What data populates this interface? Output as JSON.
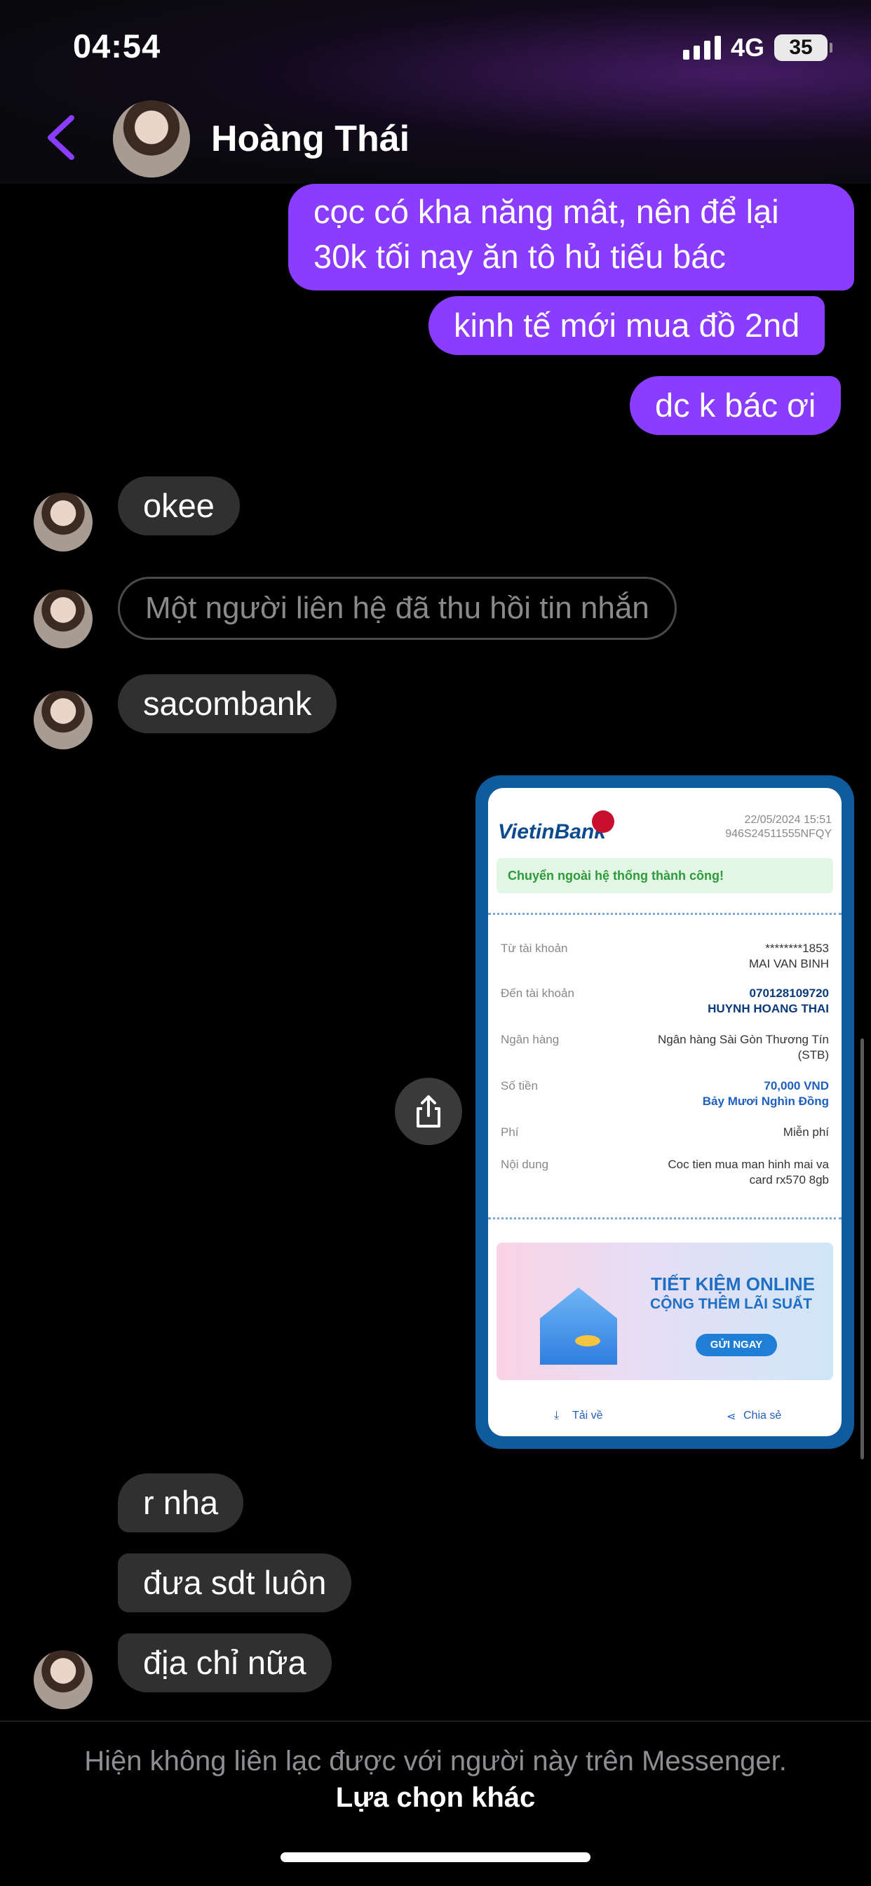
{
  "status_bar": {
    "time": "04:54",
    "network": "4G",
    "battery": "35"
  },
  "header": {
    "contact_name": "Hoàng Thái"
  },
  "messages": {
    "sent_1": "cọc có kha năng mât, nên để lại\n30k tối nay ăn tô hủ tiếu bác",
    "sent_2": "kinh tế mới mua đồ 2nd",
    "sent_3": "dc k bác ơi",
    "recv_1": "okee",
    "unsent": "Một người liên hệ đã thu hồi tin nhắn",
    "recv_2": "sacombank",
    "recv_3": "r nha",
    "recv_4": "đưa sdt luôn",
    "recv_5": "địa chỉ nữa"
  },
  "receipt": {
    "logo": "VietinBank",
    "date": "22/05/2024 15:51",
    "ref": "946S24511555NFQY",
    "success": "Chuyển ngoài hệ thống thành công!",
    "rows": [
      {
        "label": "Từ tài khoản",
        "value1": "********1853",
        "value2": "MAI VAN BINH"
      },
      {
        "label": "Đến tài khoản",
        "value1": "070128109720",
        "value2": "HUYNH HOANG THAI"
      },
      {
        "label": "Ngân hàng",
        "value1": "Ngân hàng Sài Gòn Thương Tín",
        "value2": "(STB)"
      },
      {
        "label": "Số tiền",
        "value1": "70,000 VND",
        "value2": "Bảy Mươi Nghìn Đồng"
      },
      {
        "label": "Phí",
        "value1": "Miễn phí",
        "value2": ""
      },
      {
        "label": "Nội dung",
        "value1": "Coc tien mua man hinh mai va",
        "value2": "card rx570 8gb"
      }
    ],
    "banner_title": "TIẾT KIỆM ONLINE",
    "banner_subtitle": "CỘNG THÊM LÃI SUẤT",
    "banner_button": "GỬI NGAY",
    "download": "Tải về",
    "share": "Chia sẻ"
  },
  "footer": {
    "note": "Hiện không liên lạc được với người này trên Messenger.",
    "link": "Lựa chọn khác"
  },
  "colors": {
    "sent_bubble": "#8a3dff",
    "recv_bubble": "#303030",
    "accent": "#8a3dff"
  }
}
